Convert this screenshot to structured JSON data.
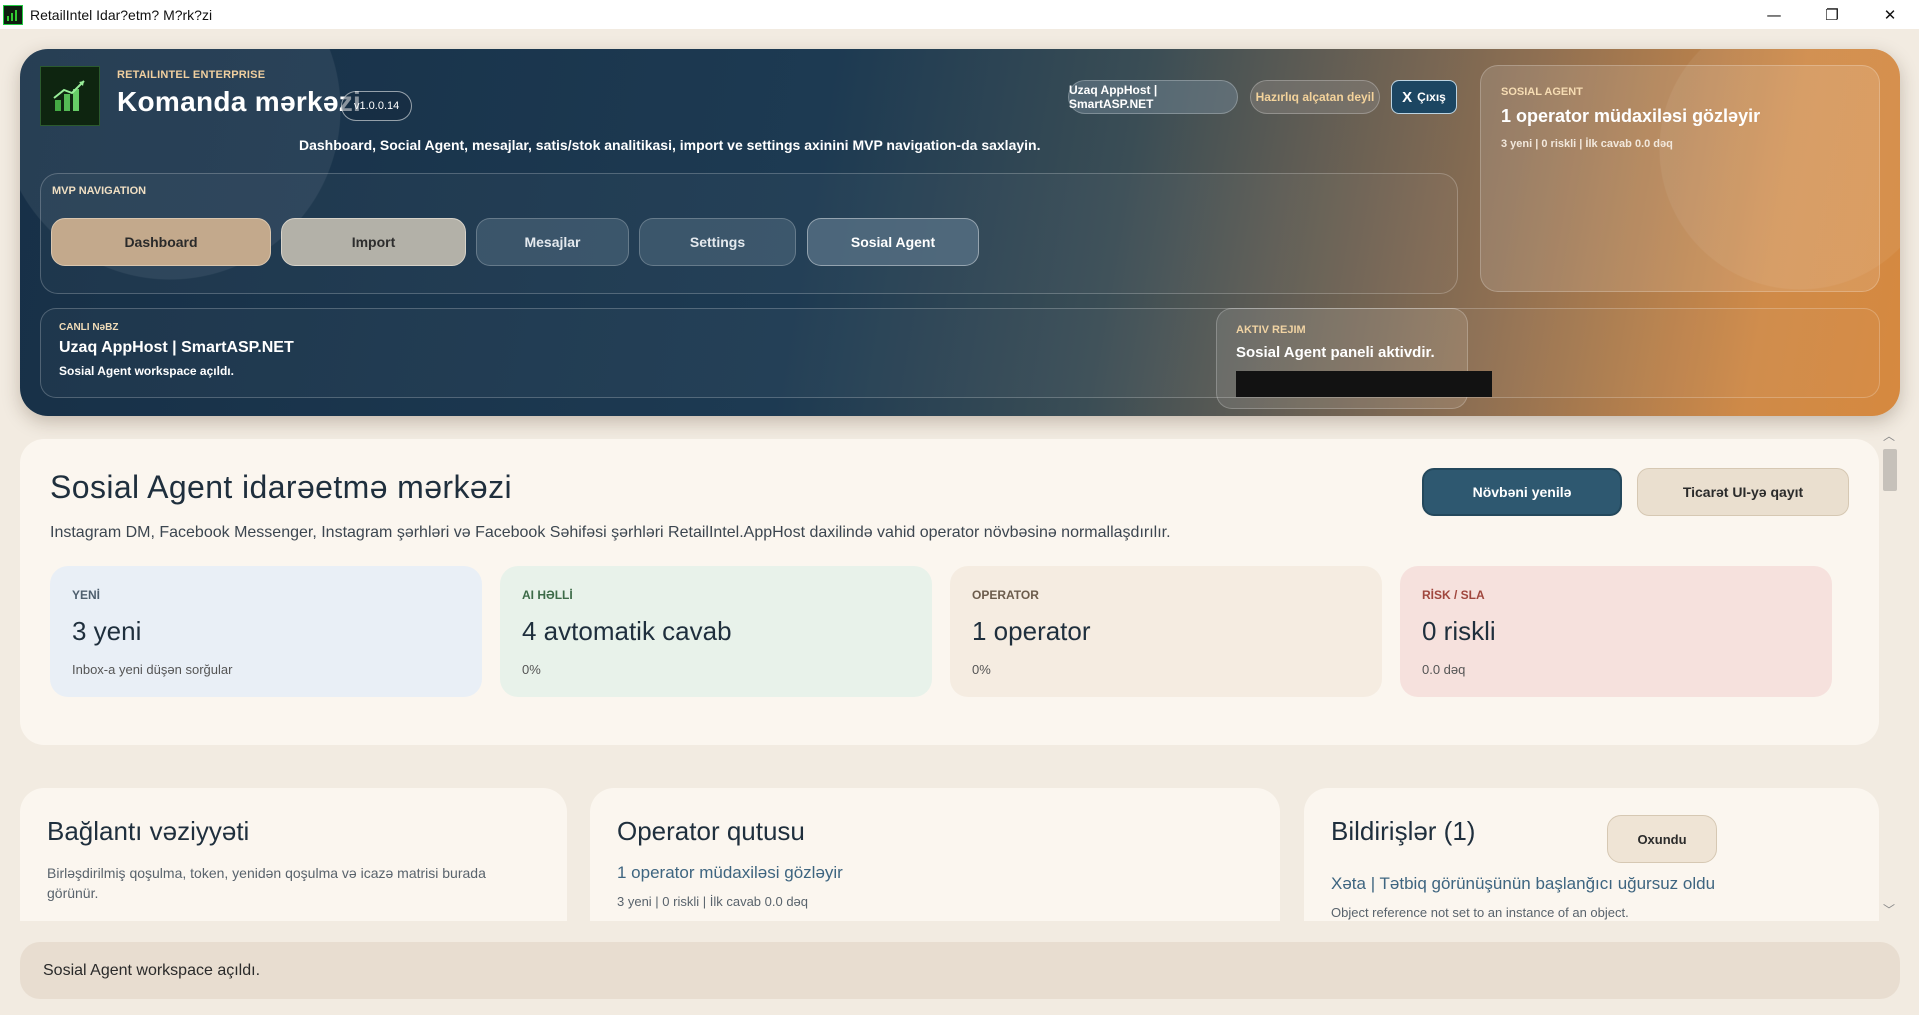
{
  "window": {
    "title": "RetailIntel Idar?etm? M?rk?zi",
    "controls": {
      "minimize": "—",
      "maximize": "❐",
      "close": "✕"
    }
  },
  "header": {
    "brand_kicker": "RETAILINTEL ENTERPRISE",
    "brand_title": "Komanda mərkəzi",
    "version": "v1.0.0.14",
    "description": "Dashboard, Social Agent, mesajlar, satis/stok analitikasi, import ve settings axinini MVP navigation-da saxlayin.",
    "host_pill": "Uzaq AppHost | SmartASP.NET",
    "ready_pill": "Hazırlıq alçatan deyil",
    "exit_icon": "X",
    "exit_label": "Çıxış",
    "agent_card": {
      "kicker": "SOSIAL AGENT",
      "headline": "1 operator müdaxiləsi gözləyir",
      "sub": "3 yeni | 0 riskli | İlk cavab 0.0 dəq"
    },
    "nav": {
      "kicker": "MVP NAVIGATION",
      "items": [
        "Dashboard",
        "Import",
        "Mesajlar",
        "Settings",
        "Sosial Agent"
      ],
      "active": "Sosial Agent"
    },
    "mode_card": {
      "kicker": "AKTIV REJIM",
      "value": "Sosial Agent paneli aktivdir."
    },
    "pulse": {
      "kicker": "CANLI NəBZ",
      "value": "Uzaq AppHost | SmartASP.NET",
      "sub": "Sosial Agent workspace açıldı."
    }
  },
  "main": {
    "title": "Sosial Agent idarəetmə mərkəzi",
    "description": "Instagram DM, Facebook Messenger, Instagram şərhləri və Facebook Səhifəsi şərhləri RetailIntel.AppHost daxilində vahid operator növbəsinə normallaşdırılır.",
    "refresh_button": "Növbəni yenilə",
    "back_button": "Ticarət UI-yə qayıt",
    "stats": [
      {
        "label": "YENİ",
        "value": "3 yeni",
        "sub": "Inbox-a yeni düşən sorğular"
      },
      {
        "label": "AI HƏLLİ",
        "value": "4 avtomatik cavab",
        "sub": "0%"
      },
      {
        "label": "OPERATOR",
        "value": "1 operator",
        "sub": "0%"
      },
      {
        "label": "RİSK / SLA",
        "value": "0 riskli",
        "sub": "0.0 dəq"
      }
    ]
  },
  "cards": {
    "connection": {
      "title": "Bağlantı vəziyyəti",
      "description": "Birləşdirilmiş qoşulma, token, yenidən qoşulma və icazə matrisi burada görünür."
    },
    "operator": {
      "title": "Operator qutusu",
      "headline": "1 operator müdaxiləsi gözləyir",
      "sub": "3 yeni | 0 riskli | İlk cavab 0.0 dəq"
    },
    "notifications": {
      "title": "Bildirişlər (1)",
      "read_button": "Oxundu",
      "headline": "Xəta | Tətbiq görünüşünün başlanğıcı uğursuz oldu",
      "sub": "Object reference not set to an instance of an object."
    }
  },
  "status_bar": {
    "text": "Sosial Agent workspace açıldı."
  },
  "scrollbar": {
    "up_arrow": "︿",
    "down_arrow": "﹀"
  },
  "colors": {
    "accent_dark": "#2e5870",
    "accent_orange": "#d6893f",
    "page_bg": "#f2ebe1",
    "risk": "#a0473e"
  }
}
